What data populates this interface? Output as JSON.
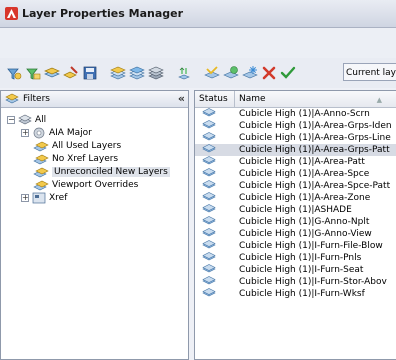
{
  "window": {
    "title": "Layer Properties Manager"
  },
  "toolbar": {
    "buttons": [
      {
        "name": "new-property-filter-icon"
      },
      {
        "name": "new-group-filter-icon"
      },
      {
        "name": "layer-states-manager-icon"
      },
      {
        "name": "layer-translator-icon"
      },
      {
        "name": "save-icon"
      },
      {
        "name": "new-layer-icon"
      },
      {
        "name": "new-layer-vp-frozen-icon"
      },
      {
        "name": "delete-filter-icon"
      },
      {
        "name": "refresh-icon"
      },
      {
        "name": "set-current-icon"
      },
      {
        "name": "new-layer-2-icon"
      },
      {
        "name": "new-layer-frozen-icon"
      },
      {
        "name": "delete-layer-icon"
      },
      {
        "name": "set-current-check-icon"
      }
    ],
    "current_layer_label": "Current laye"
  },
  "filters": {
    "header": "Filters",
    "collapse_glyph": "«",
    "tree": [
      {
        "label": "All",
        "level": 0,
        "expander": "⊟"
      },
      {
        "label": "AIA Major",
        "level": 1,
        "expander": "⊞"
      },
      {
        "label": "All Used Layers",
        "level": 1,
        "expander": ""
      },
      {
        "label": "No Xref Layers",
        "level": 1,
        "expander": ""
      },
      {
        "label": "Unreconciled New Layers",
        "level": 1,
        "expander": "",
        "selected": true
      },
      {
        "label": "Viewport Overrides",
        "level": 1,
        "expander": ""
      },
      {
        "label": "Xref",
        "level": 1,
        "expander": "⊞"
      }
    ]
  },
  "layers": {
    "columns": {
      "status": "Status",
      "name": "Name"
    },
    "sort_glyph": "▲",
    "rows": [
      {
        "name": "Cubicle High (1)|A-Anno-Scrn"
      },
      {
        "name": "Cubicle High (1)|A-Area-Grps-Iden"
      },
      {
        "name": "Cubicle High (1)|A-Area-Grps-Line"
      },
      {
        "name": "Cubicle High (1)|A-Area-Grps-Patt",
        "selected": true
      },
      {
        "name": "Cubicle High (1)|A-Area-Patt"
      },
      {
        "name": "Cubicle High (1)|A-Area-Spce"
      },
      {
        "name": "Cubicle High (1)|A-Area-Spce-Patt"
      },
      {
        "name": "Cubicle High (1)|A-Area-Zone"
      },
      {
        "name": "Cubicle High (1)|ASHADE"
      },
      {
        "name": "Cubicle High (1)|G-Anno-Nplt"
      },
      {
        "name": "Cubicle High (1)|G-Anno-View"
      },
      {
        "name": "Cubicle High (1)|I-Furn-File-Blow"
      },
      {
        "name": "Cubicle High (1)|I-Furn-Pnls"
      },
      {
        "name": "Cubicle High (1)|I-Furn-Seat"
      },
      {
        "name": "Cubicle High (1)|I-Furn-Stor-Abov"
      },
      {
        "name": "Cubicle High (1)|I-Furn-Wksf"
      }
    ]
  }
}
